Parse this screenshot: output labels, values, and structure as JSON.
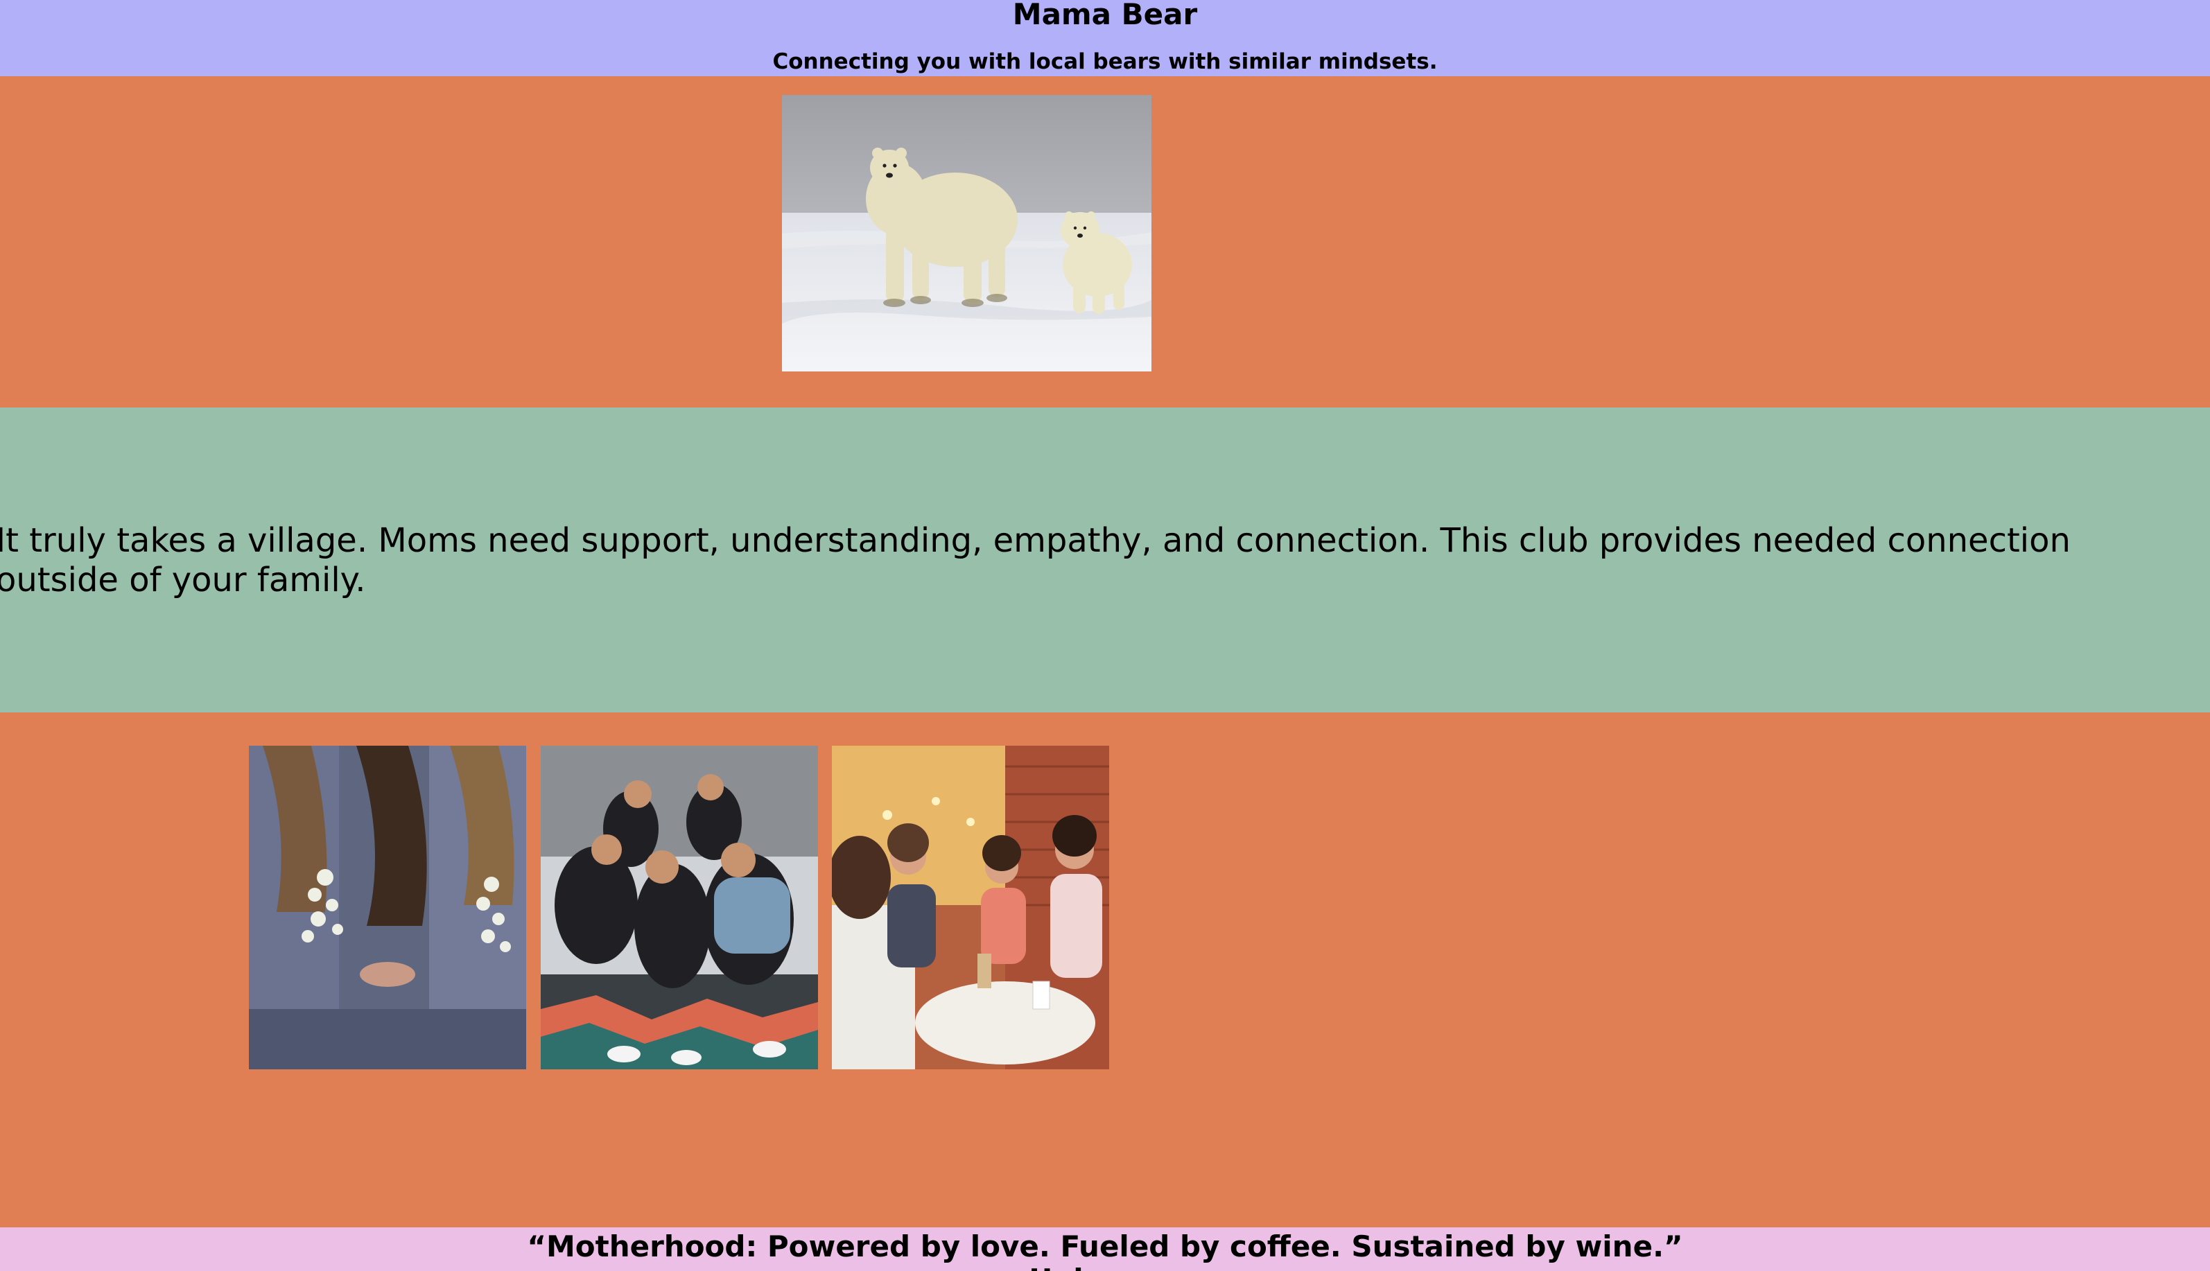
{
  "header": {
    "title": "Mama Bear",
    "tagline": "Connecting you with local bears with similar mindsets."
  },
  "hero": {
    "image": "polar-bear-mother-and-cub-photo"
  },
  "mission": {
    "text": "It truly takes a village. Moms need support, understanding, empathy, and connection. This club provides needed connection outside of your family."
  },
  "gallery": {
    "images": [
      "women-in-denim-jackets-photo",
      "group-of-friends-on-stairs-photo",
      "women-chatting-at-cafe-photo"
    ]
  },
  "footer": {
    "quote": "“Motherhood: Powered by love. Fueled by coffee. Sustained by wine.”",
    "author": "Unknown"
  },
  "colors": {
    "header_bg": "#b2b0f8",
    "section_orange": "#e07f53",
    "section_green": "#97bfa9",
    "footer_bg": "#ecc0e6"
  }
}
